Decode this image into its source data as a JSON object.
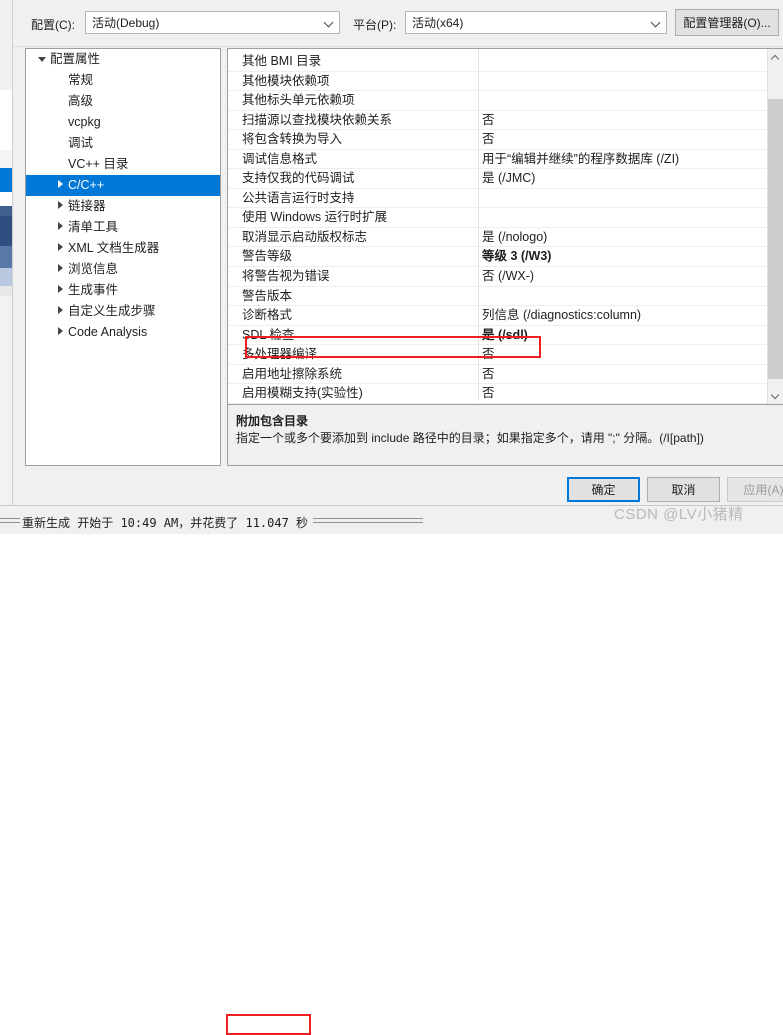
{
  "toolbar": {
    "config_label": "配置(C):",
    "config_value": "活动(Debug)",
    "platform_label": "平台(P):",
    "platform_value": "活动(x64)",
    "config_manager_button": "配置管理器(O)..."
  },
  "tree": {
    "items": [
      {
        "label": "配置属性",
        "indent": 0,
        "twisty": "down",
        "selected": false
      },
      {
        "label": "常规",
        "indent": 1,
        "twisty": "none",
        "selected": false
      },
      {
        "label": "高级",
        "indent": 1,
        "twisty": "none",
        "selected": false
      },
      {
        "label": "vcpkg",
        "indent": 1,
        "twisty": "none",
        "selected": false
      },
      {
        "label": "调试",
        "indent": 1,
        "twisty": "none",
        "selected": false
      },
      {
        "label": "VC++ 目录",
        "indent": 1,
        "twisty": "none",
        "selected": false
      },
      {
        "label": "C/C++",
        "indent": 1,
        "twisty": "right",
        "selected": true
      },
      {
        "label": "链接器",
        "indent": 1,
        "twisty": "right",
        "selected": false
      },
      {
        "label": "清单工具",
        "indent": 1,
        "twisty": "right",
        "selected": false
      },
      {
        "label": "XML 文档生成器",
        "indent": 1,
        "twisty": "right",
        "selected": false
      },
      {
        "label": "浏览信息",
        "indent": 1,
        "twisty": "right",
        "selected": false
      },
      {
        "label": "生成事件",
        "indent": 1,
        "twisty": "right",
        "selected": false
      },
      {
        "label": "自定义生成步骤",
        "indent": 1,
        "twisty": "right",
        "selected": false
      },
      {
        "label": "Code Analysis",
        "indent": 1,
        "twisty": "right",
        "selected": false
      }
    ]
  },
  "properties": {
    "rows": [
      {
        "name": "其他 BMI 目录",
        "value": "",
        "bold": false,
        "highlight": false
      },
      {
        "name": "其他模块依赖项",
        "value": "",
        "bold": false,
        "highlight": false
      },
      {
        "name": "其他标头单元依赖项",
        "value": "",
        "bold": false,
        "highlight": false
      },
      {
        "name": "扫描源以查找模块依赖关系",
        "value": "否",
        "bold": false,
        "highlight": false
      },
      {
        "name": "将包含转换为导入",
        "value": "否",
        "bold": false,
        "highlight": false
      },
      {
        "name": "调试信息格式",
        "value": "用于“编辑并继续”的程序数据库 (/ZI)",
        "bold": false,
        "highlight": false
      },
      {
        "name": "支持仅我的代码调试",
        "value": "是 (/JMC)",
        "bold": false,
        "highlight": false
      },
      {
        "name": "公共语言运行时支持",
        "value": "",
        "bold": false,
        "highlight": false
      },
      {
        "name": "使用 Windows 运行时扩展",
        "value": "",
        "bold": false,
        "highlight": false
      },
      {
        "name": "取消显示启动版权标志",
        "value": "是 (/nologo)",
        "bold": false,
        "highlight": false
      },
      {
        "name": "警告等级",
        "value": "等级 3 (/W3)",
        "bold": true,
        "highlight": false
      },
      {
        "name": "将警告视为错误",
        "value": "否 (/WX-)",
        "bold": false,
        "highlight": false
      },
      {
        "name": "警告版本",
        "value": "",
        "bold": false,
        "highlight": false
      },
      {
        "name": "诊断格式",
        "value": "列信息 (/diagnostics:column)",
        "bold": false,
        "highlight": false
      },
      {
        "name": "SDL 检查",
        "value": "是 (/sdl)",
        "bold": true,
        "highlight": false
      },
      {
        "name": "多处理器编译",
        "value": "否",
        "bold": false,
        "highlight": true
      },
      {
        "name": "启用地址擦除系统",
        "value": "否",
        "bold": false,
        "highlight": false
      },
      {
        "name": "启用模糊支持(实验性)",
        "value": "否",
        "bold": false,
        "highlight": false
      }
    ]
  },
  "description": {
    "title": "附加包含目录",
    "text": "指定一个或多个要添加到 include 路径中的目录；如果指定多个，请用 \";\" 分隔。(/I[path])"
  },
  "dialog_buttons": {
    "ok": "确定",
    "cancel": "取消",
    "apply": "应用(A)"
  },
  "statusbar": {
    "text": "重新生成 开始于 10:49 AM，并花费了 11.047 秒",
    "highlighted_value": "11.047 秒"
  },
  "watermark": "CSDN @LV小猪精",
  "colors": {
    "selection_blue": "#0078d7",
    "annotation_red": "#f01e1e",
    "dialog_bg": "#f0f0f0",
    "pane_bg": "#ffffff"
  }
}
